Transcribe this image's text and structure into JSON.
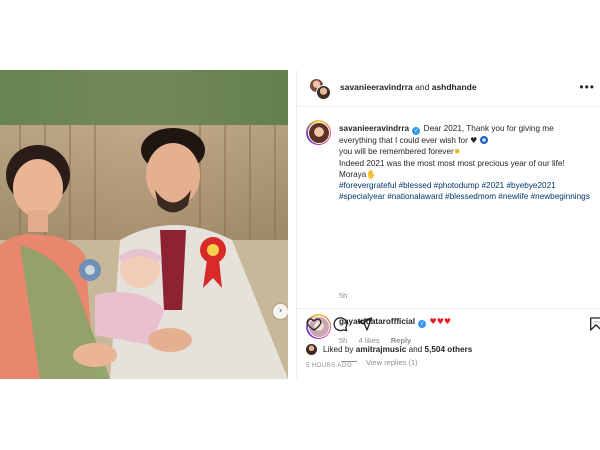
{
  "header": {
    "user1": "savanieeravindrra",
    "connector": "and",
    "user2": "ashdhande",
    "more_label": "•••"
  },
  "caption": {
    "username": "savanieeravindrra",
    "line1": "Dear 2021, Thank you for giving me everything that I could ever wish for",
    "line2": "you will be remembered forever",
    "line3": "Indeed 2021 was the most most most precious year of our life!",
    "line4": "Moraya",
    "hashtags": "#forevergrateful #blessed #photodump #2021 #byebye2021 #specialyear #nationalaward #blessedmom #newlife #newbeginnings",
    "timestamp": "5h"
  },
  "comment": {
    "username": "gayatridataroffficial",
    "time": "5h",
    "likes": "4 likes",
    "reply": "Reply",
    "view_replies": "View replies (1)"
  },
  "likes": {
    "prefix": "Liked by",
    "user": "amitrajmusic",
    "middle": "and",
    "others": "5,504 others"
  },
  "posted": "5 HOURS AGO",
  "icons": [
    "heart-icon",
    "comment-icon",
    "share-icon",
    "save-icon",
    "verified-icon",
    "more-icon",
    "carousel-next-icon"
  ],
  "colors": {
    "link": "#00376b",
    "verified": "#3897f0",
    "meta": "#8e8e8e",
    "heart_red": "#ed1c24"
  }
}
